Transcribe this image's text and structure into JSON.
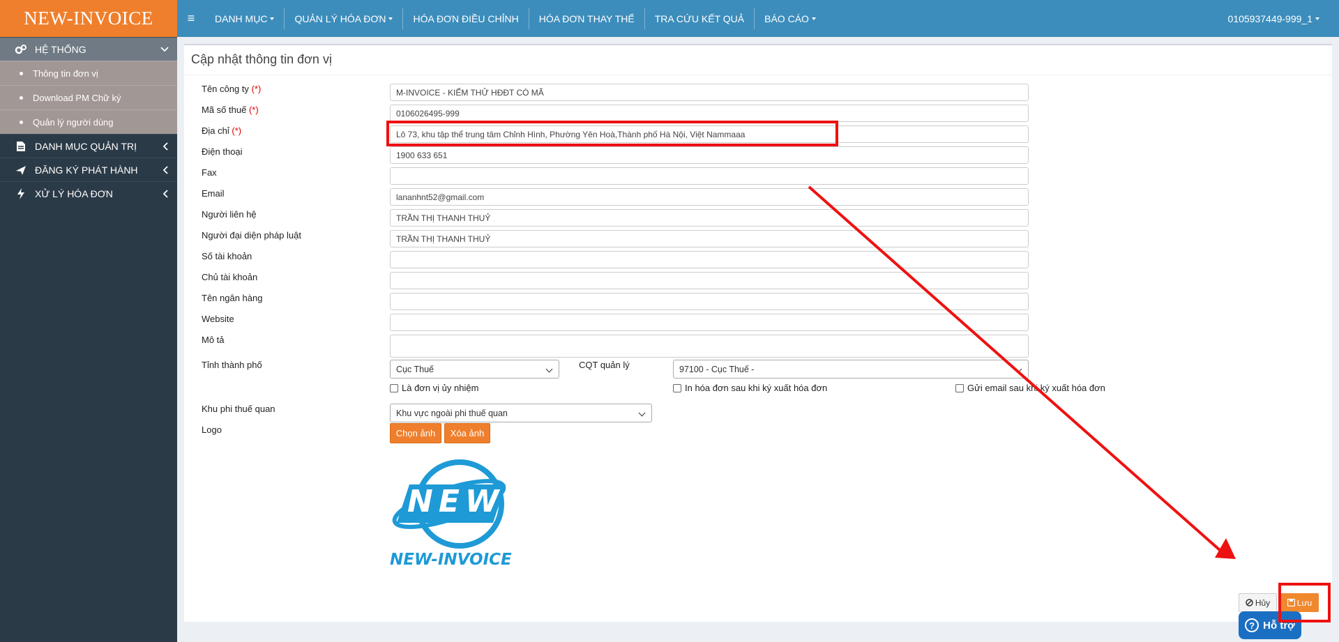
{
  "brand": "NEW-INVOICE",
  "sidebar": {
    "groups": [
      {
        "label": "HỆ THỐNG",
        "icon": "gears-icon"
      },
      {
        "label": "DANH MỤC QUẢN TRỊ",
        "icon": "document-icon"
      },
      {
        "label": "ĐĂNG KÝ PHÁT HÀNH",
        "icon": "plane-icon"
      },
      {
        "label": "XỬ LÝ HÓA ĐƠN",
        "icon": "bolt-icon"
      }
    ],
    "sub_items": [
      "Thông tin đơn vị",
      "Download PM Chữ ký",
      "Quản lý người dùng"
    ]
  },
  "topnav": {
    "items": [
      "DANH MỤC",
      "QUẢN LÝ HÓA ĐƠN",
      "HÓA ĐƠN ĐIỀU CHỈNH",
      "HÓA ĐƠN THAY THẾ",
      "TRA CỨU KẾT QUẢ",
      "BÁO CÁO"
    ],
    "user": "0105937449-999_1"
  },
  "page": {
    "title": "Cập nhật thông tin đơn vị",
    "required_mark": "(*)",
    "fields": [
      {
        "label": "Tên công ty",
        "value": "M-INVOICE - KIỂM THỬ HĐĐT CÓ MÃ"
      },
      {
        "label": "Mã số thuế",
        "value": "0106026495-999"
      },
      {
        "label": "Địa chỉ",
        "value": "Lô 73, khu tập thể trung tâm Chỉnh Hình, Phường Yên Hoà,Thành phố Hà Nội, Việt Nammaaa"
      },
      {
        "label": "Điện thoại",
        "value": "1900 633 651"
      },
      {
        "label": "Fax",
        "value": ""
      },
      {
        "label": "Email",
        "value": "lananhnt52@gmail.com"
      },
      {
        "label": "Người liên hệ",
        "value": "TRẦN THỊ THANH THUỶ"
      },
      {
        "label": "Người đại diện pháp luật",
        "value": "TRẦN THỊ THANH THUỶ"
      },
      {
        "label": "Số tài khoản",
        "value": ""
      },
      {
        "label": "Chủ tài khoản",
        "value": ""
      },
      {
        "label": "Tên ngân hàng",
        "value": ""
      },
      {
        "label": "Website",
        "value": ""
      },
      {
        "label": "Mô tả",
        "value": ""
      }
    ],
    "province": {
      "label": "Tỉnh thành phố",
      "value": "Cục Thuế"
    },
    "tax_office": {
      "label": "CQT quản lý",
      "value": "97100 - Cục Thuế -"
    },
    "checkboxes": [
      "Là đơn vị ủy nhiệm",
      "In hóa đơn sau khi ký xuất hóa đơn",
      "Gửi email sau khi ký xuất hóa đơn"
    ],
    "tariff_zone": {
      "label": "Khu phi thuế quan",
      "value": "Khu vực ngoài phi thuế quan"
    },
    "logo": {
      "label": "Logo",
      "choose": "Chọn ảnh",
      "delete": "Xóa ảnh",
      "image_text": "NEW",
      "image_caption": "NEW-INVOICE"
    },
    "cancel_label": "Hủy",
    "save_label": "Lưu",
    "support_label": "Hỗ trợ"
  },
  "colors": {
    "accent": "#ef7f2c",
    "nav": "#3c8dbc",
    "sidebar": "#2b3a47",
    "annotation": "#e11111"
  }
}
